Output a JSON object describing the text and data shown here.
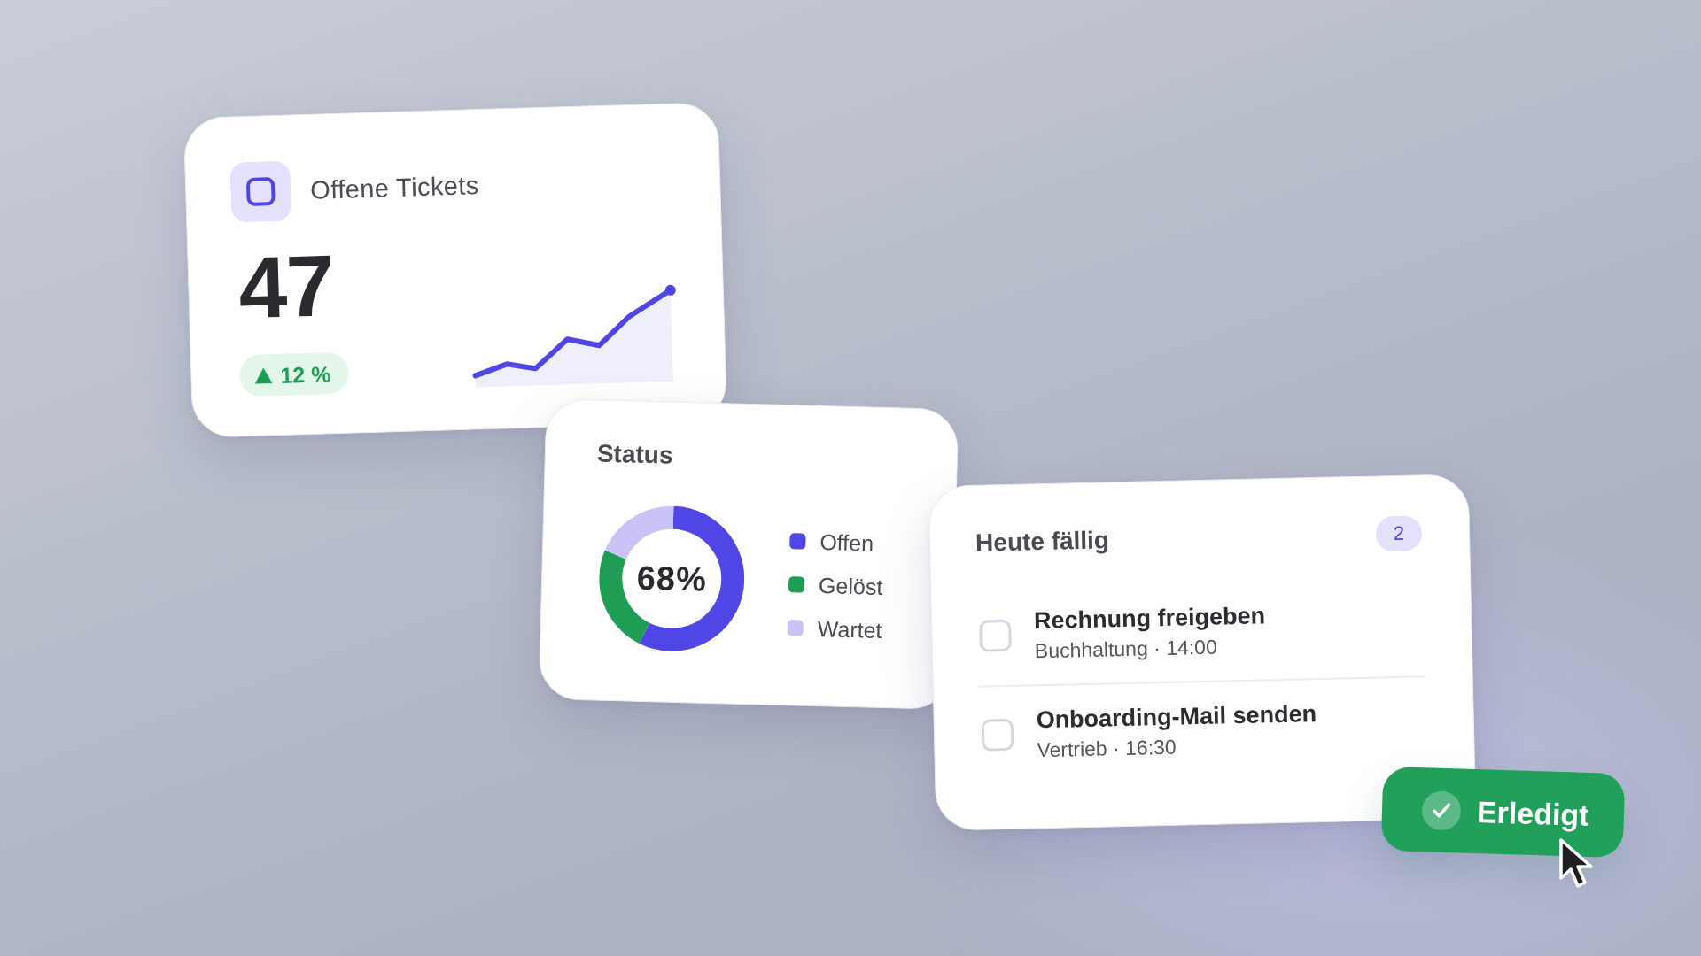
{
  "tickets_card": {
    "title": "Offene Tickets",
    "value": "47",
    "trend": {
      "up": true,
      "text": "12 %"
    }
  },
  "status_card": {
    "title": "Status",
    "chart_data": {
      "type": "donut",
      "categories": [
        "Offen",
        "Gelöst",
        "Wartet"
      ],
      "series": [
        {
          "values": [
            57,
            24,
            19
          ]
        }
      ],
      "colors": [
        "#4f46e5",
        "#1f9d55",
        "#c9c4f5"
      ],
      "annotations": [
        "68%"
      ]
    }
  },
  "due_today_card": {
    "title": "Heute fällig",
    "count": "2",
    "tasks": [
      {
        "title": "Rechnung freigeben",
        "meta": "Buchhaltung · 14:00",
        "checked": false
      },
      {
        "title": "Onboarding-Mail senden",
        "meta": "Vertrieb · 16:30",
        "checked": false
      }
    ]
  },
  "done_button": {
    "label": "Erledigt"
  }
}
